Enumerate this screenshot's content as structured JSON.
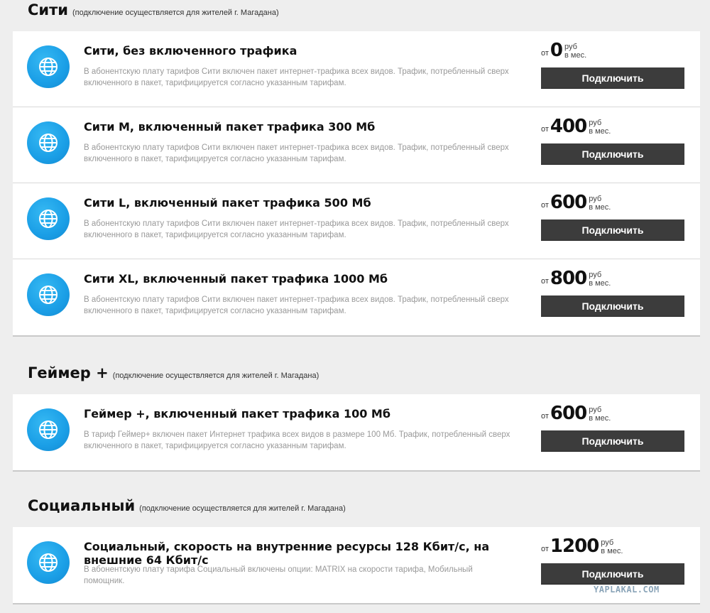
{
  "sections": [
    {
      "title": "Сити",
      "note": "(подключение осуществляется для жителей г. Магадана)",
      "plans": [
        {
          "name": "Сити, без включенного трафика",
          "description": "В абонентскую плату тарифов Сити включен пакет интернет-трафика всех видов. Трафик, потребленный сверх включенного в пакет, тарифицируется согласно указанным тарифам.",
          "price_from": "от",
          "price": "0",
          "currency": "руб",
          "period": "в мес.",
          "button": "Подключить"
        },
        {
          "name": "Сити М, включенный пакет трафика 300 Мб",
          "description": "В абонентскую плату тарифов Сити включен пакет интернет-трафика всех видов. Трафик, потребленный сверх включенного в пакет, тарифицируется согласно указанным тарифам.",
          "price_from": "от",
          "price": "400",
          "currency": "руб",
          "period": "в мес.",
          "button": "Подключить"
        },
        {
          "name": "Сити L, включенный пакет трафика 500 Мб",
          "description": "В абонентскую плату тарифов Сити включен пакет интернет-трафика всех видов. Трафик, потребленный сверх включенного в пакет, тарифицируется согласно указанным тарифам.",
          "price_from": "от",
          "price": "600",
          "currency": "руб",
          "period": "в мес.",
          "button": "Подключить"
        },
        {
          "name": "Сити XL, включенный пакет трафика 1000 Мб",
          "description": "В абонентскую плату тарифов Сити включен пакет интернет-трафика всех видов. Трафик, потребленный сверх включенного в пакет, тарифицируется согласно указанным тарифам.",
          "price_from": "от",
          "price": "800",
          "currency": "руб",
          "period": "в мес.",
          "button": "Подключить"
        }
      ]
    },
    {
      "title": "Геймер +",
      "note": "(подключение осуществляется для жителей г. Магадана)",
      "plans": [
        {
          "name": "Геймер +, включенный пакет трафика 100 Мб",
          "description": "В тариф Геймер+ включен пакет Интернет трафика всех видов в размере 100 Мб. Трафик, потребленный сверх включенного в пакет, тарифицируется согласно указанным тарифам.",
          "price_from": "от",
          "price": "600",
          "currency": "руб",
          "period": "в мес.",
          "button": "Подключить"
        }
      ]
    },
    {
      "title": "Социальный",
      "note": "(подключение осуществляется для жителей г. Магадана)",
      "plans": [
        {
          "name": "Социальный, скорость на внутренние ресурсы 128 Кбит/с, на внешние 64 Кбит/с",
          "description": "В абонентскую плату тарифа Социальный включены опции: MATRIX на скорости тарифа, Мобильный помощник.",
          "price_from": "от",
          "price": "1200",
          "currency": "руб",
          "period": "в мес.",
          "button": "Подключить"
        }
      ]
    }
  ],
  "watermark": "YAPLAKAL.COM",
  "colors": {
    "background": "#eeeeee",
    "card": "#ffffff",
    "globe": "#1a9ee6",
    "button": "#3c3c3c",
    "description": "#999999"
  },
  "icons": {
    "plan": "globe-icon"
  }
}
